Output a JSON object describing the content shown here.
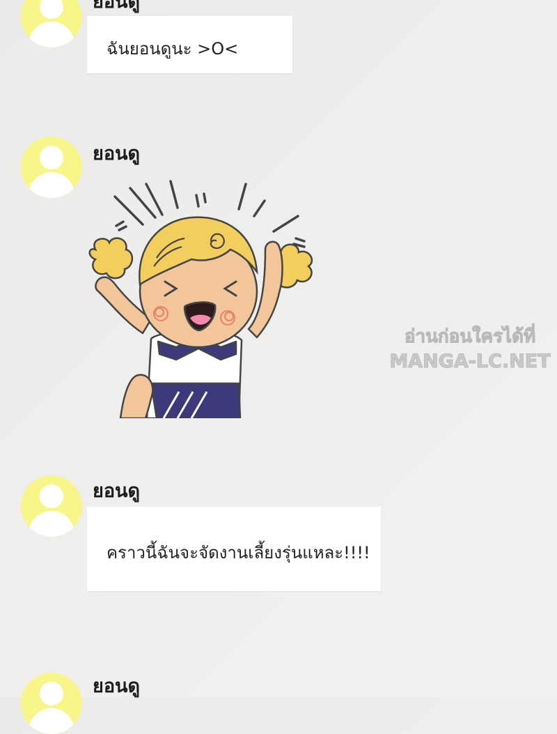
{
  "chat": {
    "messages": [
      {
        "sender": "ยอนดู",
        "text": "ฉันยอนดูนะ >O<"
      },
      {
        "sender": "ยอนดู",
        "sticker": "cheering-girl-sticker"
      },
      {
        "sender": "ยอนดู",
        "text": "คราวนี้ฉันจะจัดงานเลี้ยงรุ่นแหละ!!!!"
      },
      {
        "sender": "ยอนดู"
      }
    ]
  },
  "watermark": {
    "line1": "อ่านก่อนใครได้ที่",
    "line2": "MANGA-LC.NET"
  },
  "colors": {
    "avatar_bg": "#f8f58a",
    "bubble_bg": "#ffffff",
    "page_bg": "#eeeeec"
  },
  "icons": {
    "avatar": "default-user-icon"
  }
}
